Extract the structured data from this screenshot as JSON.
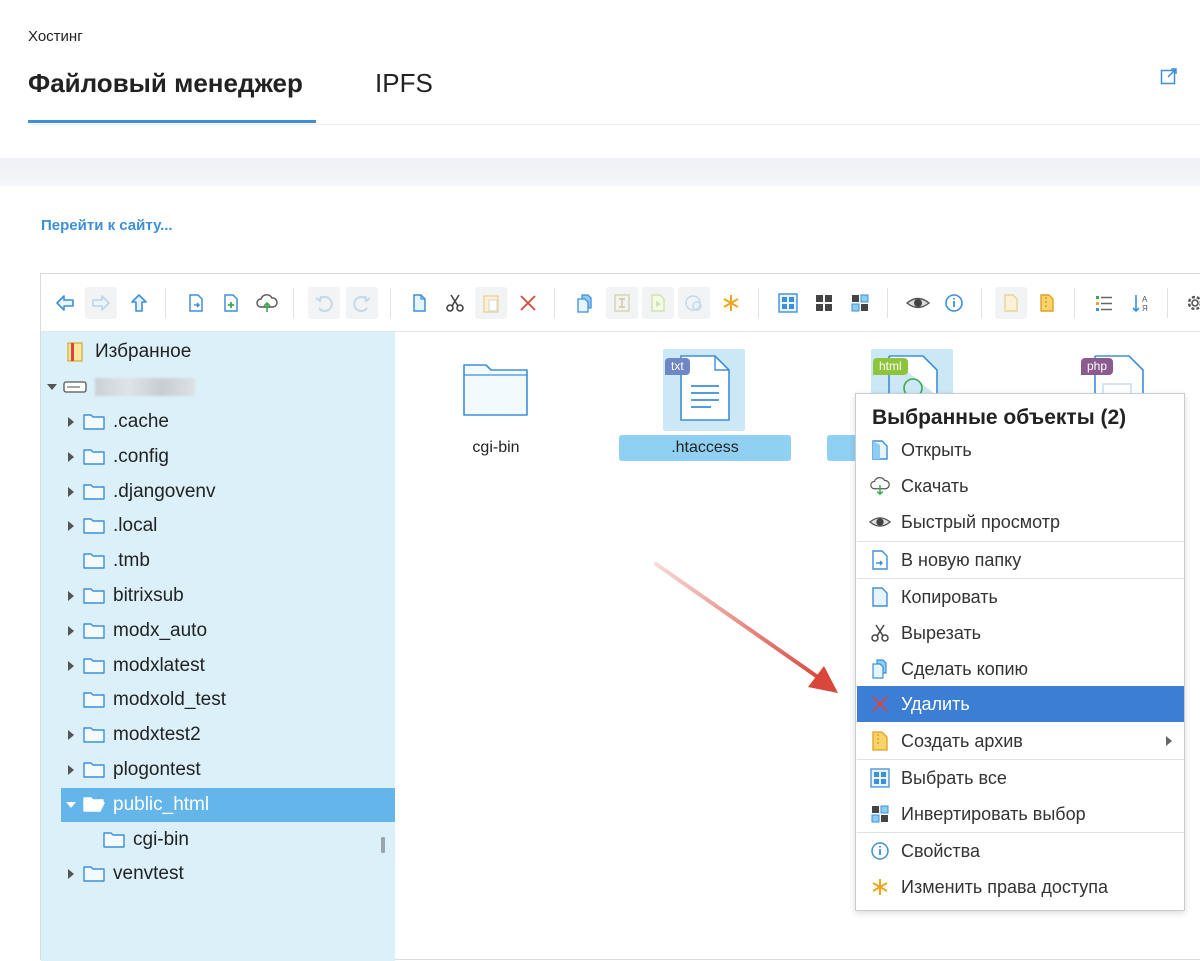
{
  "header": {
    "breadcrumb": "Хостинг",
    "tabs": [
      {
        "label": "Файловый менеджер",
        "active": true
      },
      {
        "label": "IPFS",
        "active": false
      }
    ]
  },
  "site_link": "Перейти к сайту...",
  "toolbar": {
    "buttons": [
      "back-icon",
      "forward-icon",
      "up-icon",
      "new-folder-icon",
      "new-file-icon",
      "upload-icon",
      "undo-icon",
      "redo-icon",
      "copy-icon",
      "cut-icon",
      "paste-icon",
      "delete-icon",
      "duplicate-icon",
      "rename-icon",
      "edit-icon",
      "resize-icon",
      "chmod-icon",
      "select-all-icon",
      "select-none-icon",
      "invert-select-icon",
      "preview-icon",
      "info-icon",
      "extract-icon",
      "archive-icon",
      "view-list-icon",
      "sort-icon",
      "settings-icon"
    ]
  },
  "tree": {
    "favorites": "Избранное",
    "root_name_hidden": true,
    "items": [
      {
        "label": ".cache",
        "expandable": true
      },
      {
        "label": ".config",
        "expandable": true
      },
      {
        "label": ".djangovenv",
        "expandable": true
      },
      {
        "label": ".local",
        "expandable": true
      },
      {
        "label": ".tmb",
        "expandable": false
      },
      {
        "label": "bitrixsub",
        "expandable": true
      },
      {
        "label": "modx_auto",
        "expandable": true
      },
      {
        "label": "modxlatest",
        "expandable": true
      },
      {
        "label": "modxold_test",
        "expandable": false
      },
      {
        "label": "modxtest2",
        "expandable": true
      },
      {
        "label": "plogontest",
        "expandable": true
      },
      {
        "label": "public_html",
        "expandable": true,
        "expanded": true,
        "selected": true
      },
      {
        "label": "cgi-bin",
        "child": true
      },
      {
        "label": "venvtest",
        "expandable": true
      }
    ]
  },
  "files": [
    {
      "name": "cgi-bin",
      "type": "folder",
      "selected": false
    },
    {
      "name": ".htaccess",
      "type": "txt",
      "badge": "txt",
      "selected": true
    },
    {
      "name": "",
      "type": "html",
      "badge": "html",
      "selected": true
    },
    {
      "name": "",
      "type": "php",
      "badge": "php",
      "selected": false
    }
  ],
  "context_menu": {
    "title": "Выбранные объекты (2)",
    "items": [
      {
        "label": "Открыть",
        "icon": "open-icon"
      },
      {
        "label": "Скачать",
        "icon": "download-icon"
      },
      {
        "label": "Быстрый просмотр",
        "icon": "eye-icon"
      },
      {
        "label": "В новую папку",
        "icon": "new-folder-icon"
      },
      {
        "label": "Копировать",
        "icon": "copy-icon"
      },
      {
        "label": "Вырезать",
        "icon": "scissors-icon"
      },
      {
        "label": "Сделать копию",
        "icon": "duplicate-icon"
      },
      {
        "label": "Удалить",
        "icon": "delete-icon",
        "highlighted": true
      },
      {
        "label": "Создать архив",
        "icon": "archive-icon",
        "submenu": true
      },
      {
        "label": "Выбрать все",
        "icon": "select-all-icon"
      },
      {
        "label": "Инвертировать выбор",
        "icon": "invert-select-icon"
      },
      {
        "label": "Свойства",
        "icon": "info-icon"
      },
      {
        "label": "Изменить права доступа",
        "icon": "chmod-icon"
      }
    ]
  },
  "colors": {
    "accent": "#3d8fd9",
    "tree_bg": "#dcf0f9",
    "tree_selected": "#64b5ea",
    "menu_highlight": "#3d7ed5",
    "annotation_arrow": "#d9473b"
  }
}
